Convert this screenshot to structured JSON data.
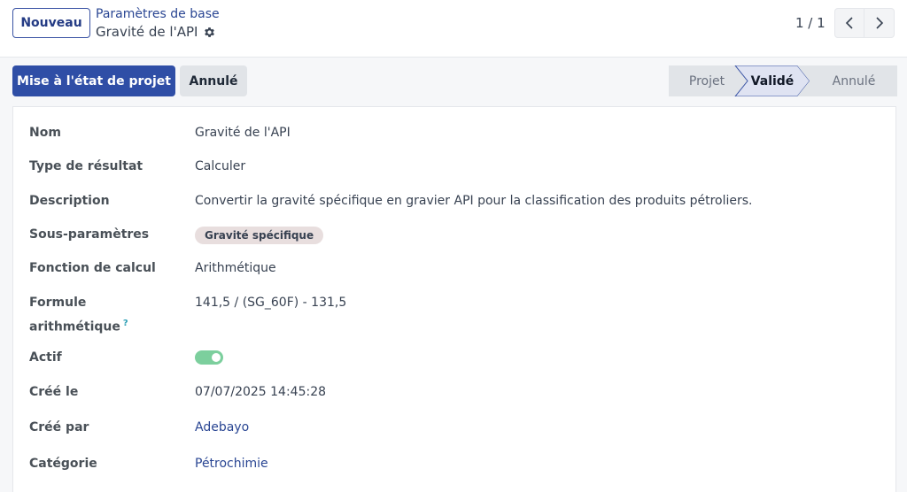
{
  "header": {
    "new_button": "Nouveau",
    "breadcrumb_parent": "Paramètres de base",
    "breadcrumb_current": "Gravité de l'API",
    "pager": "1 / 1"
  },
  "actions": {
    "set_draft": "Mise à l'état de projet",
    "cancel": "Annulé"
  },
  "statusbar": {
    "stages": [
      "Projet",
      "Validé",
      "Annulé"
    ],
    "active": "Validé"
  },
  "form": {
    "name_label": "Nom",
    "name_value": "Gravité de l'API",
    "result_type_label": "Type de résultat",
    "result_type_value": "Calculer",
    "description_label": "Description",
    "description_value": "Convertir la gravité spécifique en gravier API pour la classification des produits pétroliers.",
    "sub_params_label": "Sous-paramètres",
    "sub_params_tag": "Gravité spécifique",
    "calc_function_label": "Fonction de calcul",
    "calc_function_value": "Arithmétique",
    "formula_label_line1": "Formule",
    "formula_label_line2": "arithmétique",
    "formula_help": "?",
    "formula_value": "141,5 / (SG_60F) - 131,5",
    "active_label": "Actif",
    "active_value": true,
    "created_on_label": "Créé le",
    "created_on_value": "07/07/2025 14:45:28",
    "created_by_label": "Créé par",
    "created_by_value": "Adebayo",
    "category_label": "Catégorie",
    "category_value": "Pétrochimie"
  },
  "colors": {
    "primary": "#2f4ea6",
    "link": "#2a4693",
    "toggle_on": "#7ccf9d",
    "status_active_bg": "#dfe3f2"
  },
  "icons": {
    "gear": "gear-icon",
    "prev": "chevron-left-icon",
    "next": "chevron-right-icon"
  }
}
